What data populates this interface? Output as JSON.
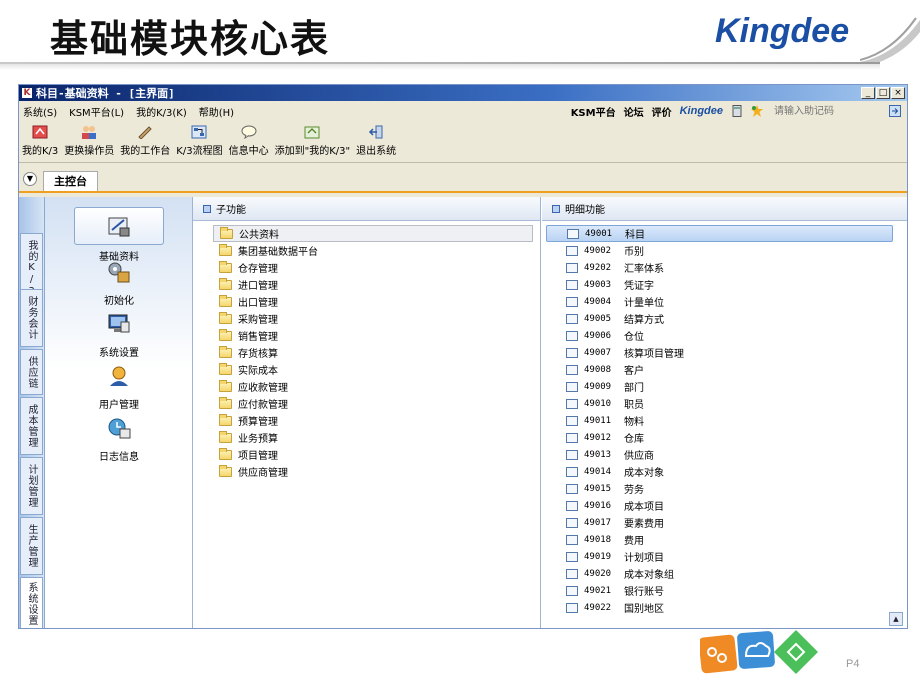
{
  "slide": {
    "title": "基础模块核心表",
    "brand": "Kingdee",
    "page_number": "P4"
  },
  "window": {
    "title": "科目-基础资料 - [主界面]",
    "controls": [
      "_",
      "□",
      "×"
    ]
  },
  "menubar": {
    "items": [
      "系统(S)",
      "KSM平台(L)",
      "我的K/3(K)",
      "帮助(H)"
    ],
    "links": [
      "KSM平台",
      "论坛",
      "评价"
    ],
    "brand": "Kingdee",
    "helpcode_placeholder": "请输入助记码"
  },
  "toolbar": {
    "items": [
      {
        "label": "我的K/3",
        "icon": "home-icon"
      },
      {
        "label": "更换操作员",
        "icon": "users-icon"
      },
      {
        "label": "我的工作台",
        "icon": "pen-icon"
      },
      {
        "label": "K/3流程图",
        "icon": "flowchart-icon"
      },
      {
        "label": "信息中心",
        "icon": "message-icon"
      },
      {
        "label": "添加到\"我的K/3\"",
        "icon": "add-favorite-icon"
      },
      {
        "label": "退出系统",
        "icon": "exit-icon"
      }
    ]
  },
  "tabs": {
    "main": "主控台"
  },
  "side_tabs": [
    "我的K/3",
    "财务会计",
    "供应链",
    "成本管理",
    "计划管理",
    "生产管理",
    "系统设置"
  ],
  "nav": {
    "items": [
      {
        "label": "基础资料",
        "icon": "basic-data-icon"
      },
      {
        "label": "初始化",
        "icon": "initialize-icon"
      },
      {
        "label": "系统设置",
        "icon": "system-settings-icon"
      },
      {
        "label": "用户管理",
        "icon": "user-management-icon"
      },
      {
        "label": "日志信息",
        "icon": "log-icon"
      }
    ]
  },
  "sub_panel": {
    "header": "子功能",
    "items": [
      "公共资料",
      "集团基础数据平台",
      "仓存管理",
      "进口管理",
      "出口管理",
      "采购管理",
      "销售管理",
      "存货核算",
      "实际成本",
      "应收款管理",
      "应付款管理",
      "预算管理",
      "业务预算",
      "项目管理",
      "供应商管理"
    ]
  },
  "detail_panel": {
    "header": "明细功能",
    "items": [
      {
        "code": "49001",
        "name": "科目"
      },
      {
        "code": "49002",
        "name": "币别"
      },
      {
        "code": "49202",
        "name": "汇率体系"
      },
      {
        "code": "49003",
        "name": "凭证字"
      },
      {
        "code": "49004",
        "name": "计量单位"
      },
      {
        "code": "49005",
        "name": "结算方式"
      },
      {
        "code": "49006",
        "name": "仓位"
      },
      {
        "code": "49007",
        "name": "核算项目管理"
      },
      {
        "code": "49008",
        "name": "客户"
      },
      {
        "code": "49009",
        "name": "部门"
      },
      {
        "code": "49010",
        "name": "职员"
      },
      {
        "code": "49011",
        "name": "物料"
      },
      {
        "code": "49012",
        "name": "仓库"
      },
      {
        "code": "49013",
        "name": "供应商"
      },
      {
        "code": "49014",
        "name": "成本对象"
      },
      {
        "code": "49015",
        "name": "劳务"
      },
      {
        "code": "49016",
        "name": "成本项目"
      },
      {
        "code": "49017",
        "name": "要素费用"
      },
      {
        "code": "49018",
        "name": "费用"
      },
      {
        "code": "49019",
        "name": "计划项目"
      },
      {
        "code": "49020",
        "name": "成本对象组"
      },
      {
        "code": "49021",
        "name": "银行账号"
      },
      {
        "code": "49022",
        "name": "国别地区"
      }
    ]
  },
  "colors": {
    "titlebar": "#0a246a",
    "accent_tab": "#f0a020",
    "brand_blue": "#1a4fa3"
  }
}
